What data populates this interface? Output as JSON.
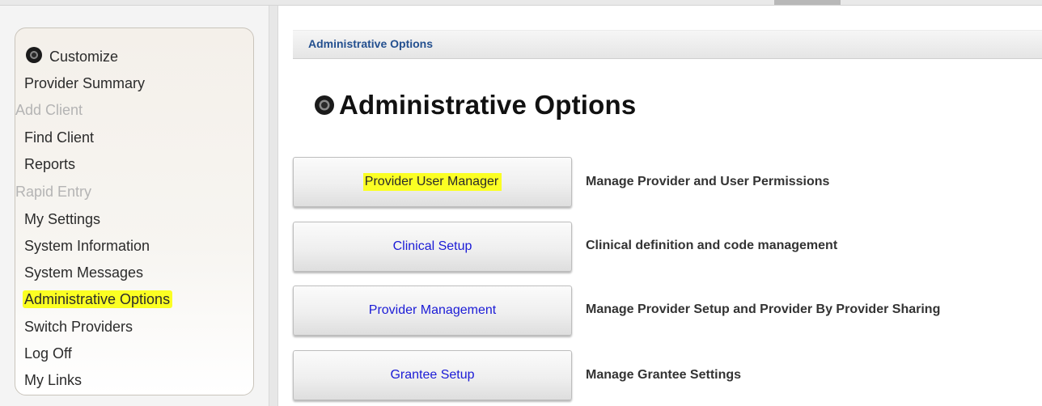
{
  "sidebar": {
    "items": [
      {
        "label": "Customize",
        "state": "normal"
      },
      {
        "label": "Provider Summary",
        "state": "normal"
      },
      {
        "label": "Add Client",
        "state": "disabled"
      },
      {
        "label": "Find Client",
        "state": "normal"
      },
      {
        "label": "Reports",
        "state": "normal"
      },
      {
        "label": "Rapid Entry",
        "state": "disabled"
      },
      {
        "label": "My Settings",
        "state": "normal"
      },
      {
        "label": "System Information",
        "state": "normal"
      },
      {
        "label": "System Messages",
        "state": "normal"
      },
      {
        "label": "Administrative Options",
        "state": "highlighted"
      },
      {
        "label": "Switch Providers",
        "state": "normal"
      },
      {
        "label": "Log Off",
        "state": "normal"
      },
      {
        "label": "My Links",
        "state": "normal"
      }
    ]
  },
  "breadcrumb": {
    "label": "Administrative Options"
  },
  "main": {
    "title": "Administrative Options",
    "options": [
      {
        "button": "Provider User Manager",
        "description": "Manage Provider and User Permissions"
      },
      {
        "button": "Clinical Setup",
        "description": "Clinical definition and code management"
      },
      {
        "button": "Provider Management",
        "description": "Manage Provider Setup and Provider By Provider Sharing"
      },
      {
        "button": "Grantee Setup",
        "description": "Manage Grantee Settings"
      }
    ]
  },
  "colors": {
    "highlight": "#fbff23",
    "link": "#1b1bd6",
    "breadcrumb": "#24508f"
  },
  "icons": {
    "bullet": "radio-bullet-icon"
  }
}
